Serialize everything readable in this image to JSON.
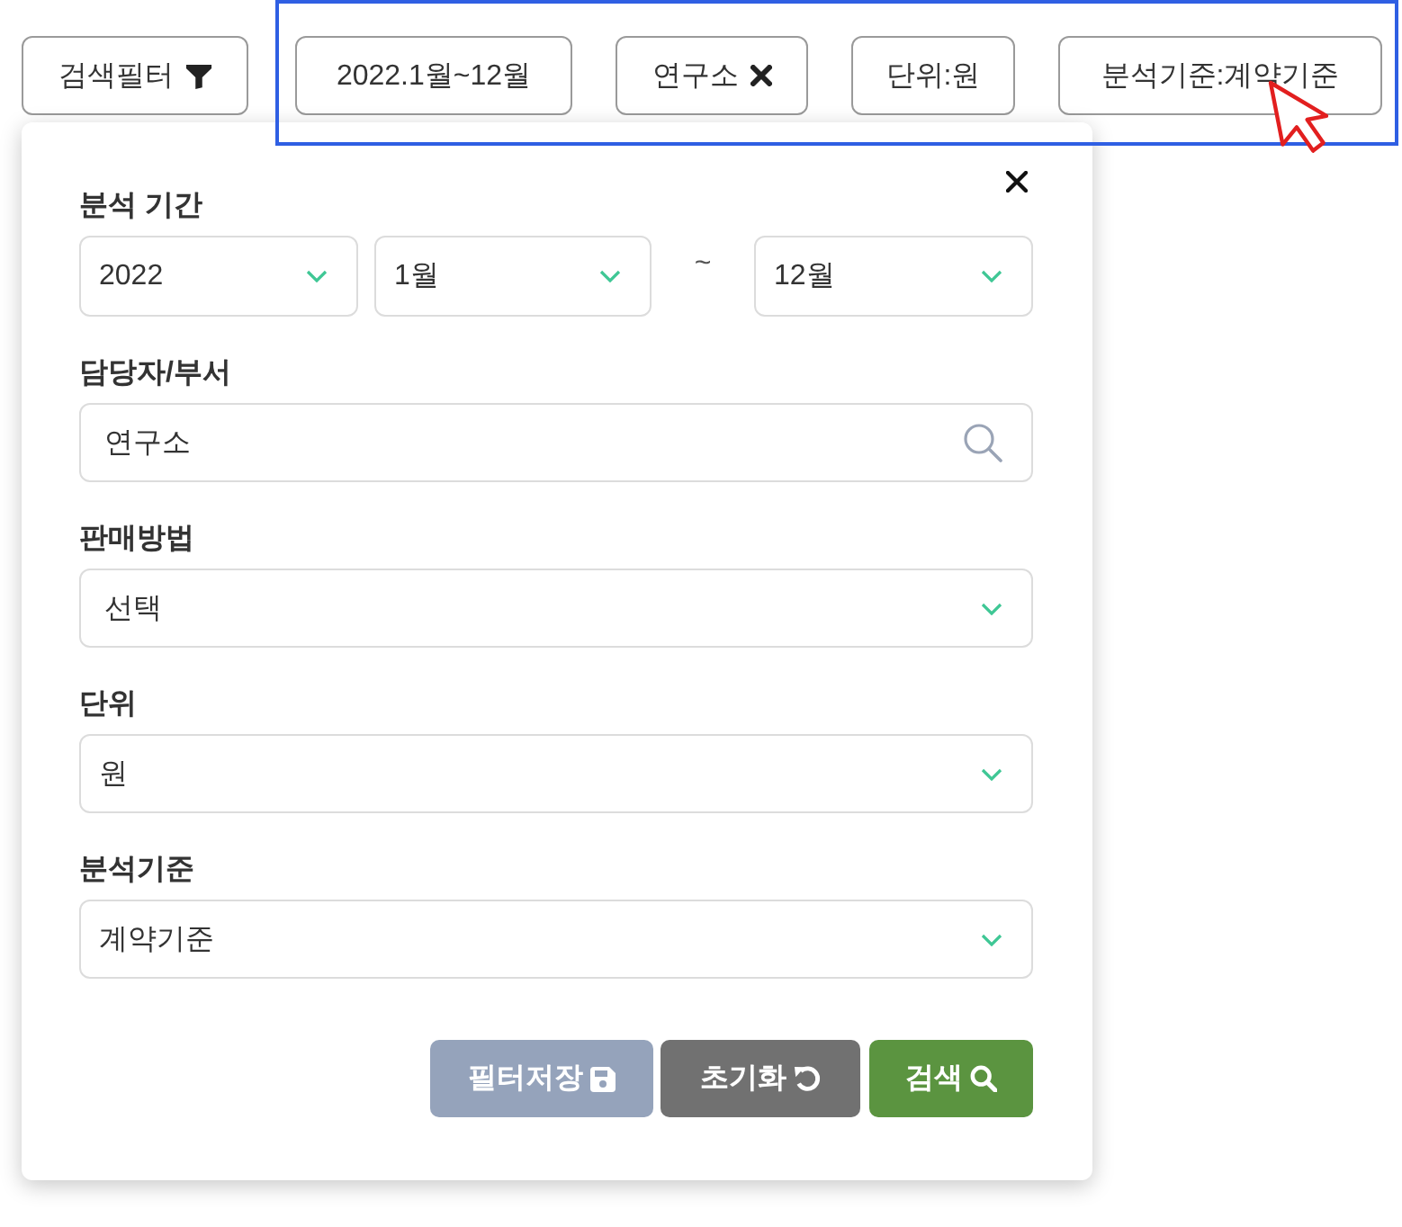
{
  "filter_button": {
    "label": "검색필터"
  },
  "chips": [
    {
      "label": "2022.1월~12월",
      "removable": false
    },
    {
      "label": "연구소",
      "removable": true
    },
    {
      "label": "단위:원",
      "removable": false
    },
    {
      "label": "분석기준:계약기준",
      "removable": false
    }
  ],
  "panel": {
    "period": {
      "label": "분석 기간",
      "year": "2022",
      "from": "1월",
      "separator": "~",
      "to": "12월"
    },
    "fields": [
      {
        "kind": "search",
        "label": "담당자/부서",
        "value": "연구소"
      },
      {
        "kind": "select",
        "label": "판매방법",
        "value": "선택"
      },
      {
        "kind": "select",
        "label": "단위",
        "value": "원"
      },
      {
        "kind": "select",
        "label": "분석기준",
        "value": "계약기준"
      }
    ],
    "buttons": [
      {
        "kind": "save",
        "label": "필터저장"
      },
      {
        "kind": "reset",
        "label": "초기화"
      },
      {
        "kind": "search",
        "label": "검색"
      }
    ]
  }
}
